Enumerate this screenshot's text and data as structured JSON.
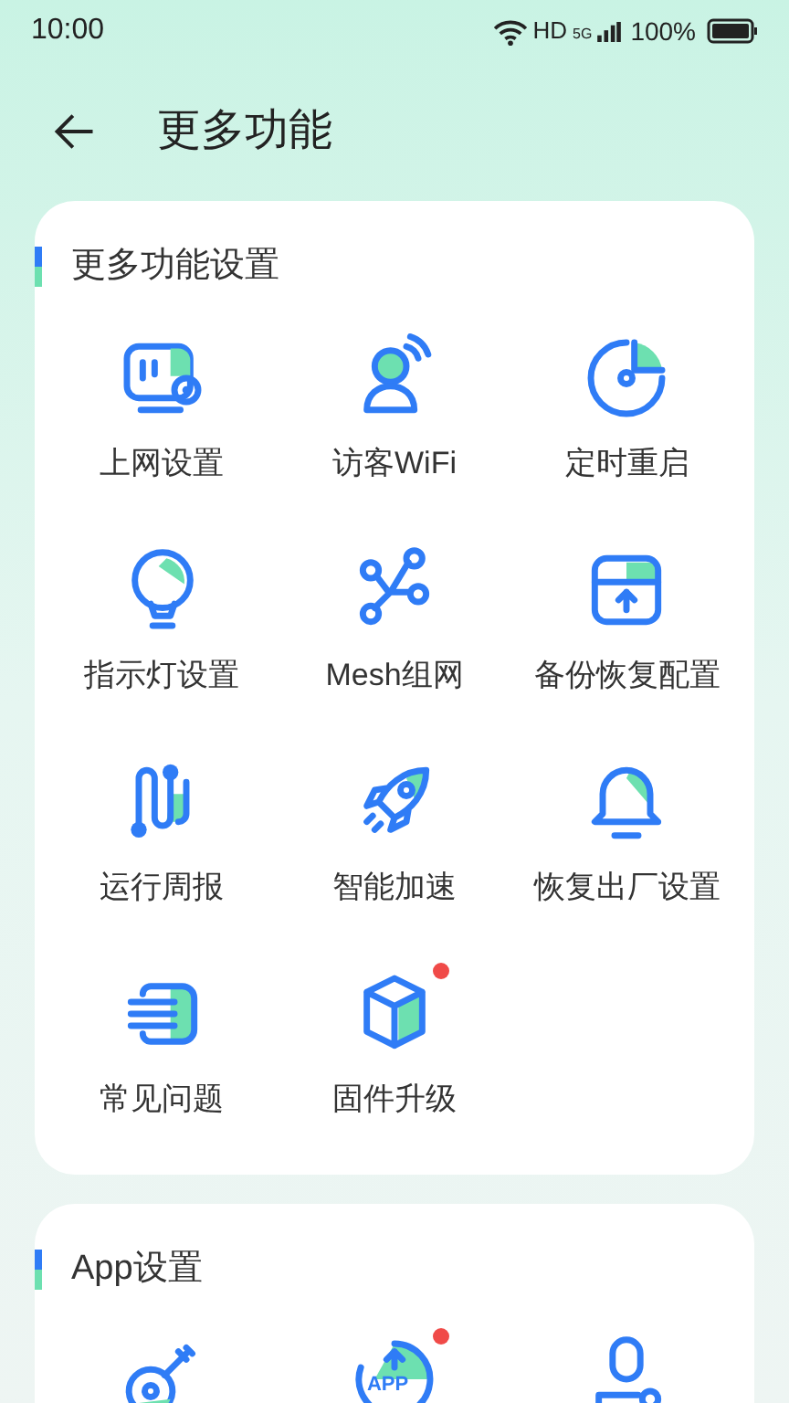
{
  "status_bar": {
    "time": "10:00",
    "network": "HD",
    "cellular": "5G",
    "battery": "100%"
  },
  "header": {
    "title": "更多功能"
  },
  "sections": [
    {
      "title": "更多功能设置",
      "items": [
        {
          "label": "上网设置",
          "has_update": false
        },
        {
          "label": "访客WiFi",
          "has_update": false
        },
        {
          "label": "定时重启",
          "has_update": false
        },
        {
          "label": "指示灯设置",
          "has_update": false
        },
        {
          "label": "Mesh组网",
          "has_update": false
        },
        {
          "label": "备份恢复配置",
          "has_update": false
        },
        {
          "label": "运行周报",
          "has_update": false
        },
        {
          "label": "智能加速",
          "has_update": false
        },
        {
          "label": "恢复出厂设置",
          "has_update": false
        },
        {
          "label": "常见问题",
          "has_update": false
        },
        {
          "label": "固件升级",
          "has_update": true
        }
      ]
    },
    {
      "title": "App设置",
      "items": [
        {
          "has_update": false
        },
        {
          "icon_text": "APP",
          "has_update": true
        },
        {
          "has_update": false
        }
      ]
    }
  ]
}
